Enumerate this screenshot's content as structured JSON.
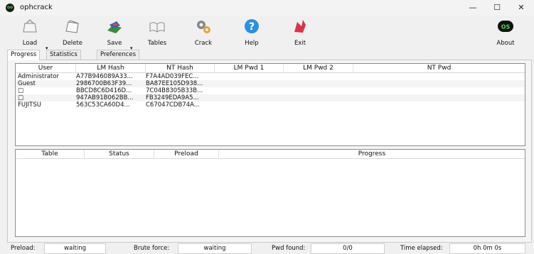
{
  "window": {
    "title": "ophcrack",
    "icon_text": "oo",
    "minimize": "—",
    "maximize": "☐",
    "close": "✕"
  },
  "toolbar": {
    "load": "Load",
    "delete": "Delete",
    "save": "Save",
    "tables": "Tables",
    "crack": "Crack",
    "help": "Help",
    "exit": "Exit",
    "about": "About",
    "about_icon_text": "OS",
    "caret": "▾"
  },
  "tabs": [
    "Progress",
    "Statistics",
    "Preferences"
  ],
  "users_table": {
    "columns": [
      "User",
      "LM Hash",
      "NT Hash",
      "LM Pwd 1",
      "LM Pwd 2",
      "NT Pwd"
    ],
    "rows": [
      [
        "Administrator",
        "A77B946089A33...",
        "F7A4AD039FEC...",
        "",
        "",
        ""
      ],
      [
        "Guest",
        "2986700B63F39...",
        "BA87EE105D938...",
        "",
        "",
        ""
      ],
      [
        "□",
        "BBCD8C6D416D...",
        "7C04B8305B33B...",
        "",
        "",
        ""
      ],
      [
        "□",
        "947AB91B062BB...",
        "FB3249EDA9A5...",
        "",
        "",
        ""
      ],
      [
        "FUJITSU",
        "563C53CA60D4...",
        "C67047CDB74A...",
        "",
        "",
        ""
      ]
    ]
  },
  "tables_table": {
    "columns": [
      "Table",
      "Status",
      "Preload",
      "Progress"
    ]
  },
  "status": {
    "preload_label": "Preload:",
    "preload_value": "waiting",
    "brute_label": "Brute force:",
    "brute_value": "waiting",
    "pwd_label": "Pwd found:",
    "pwd_value": "0/0",
    "time_label": "Time elapsed:",
    "time_value": "0h 0m 0s"
  }
}
